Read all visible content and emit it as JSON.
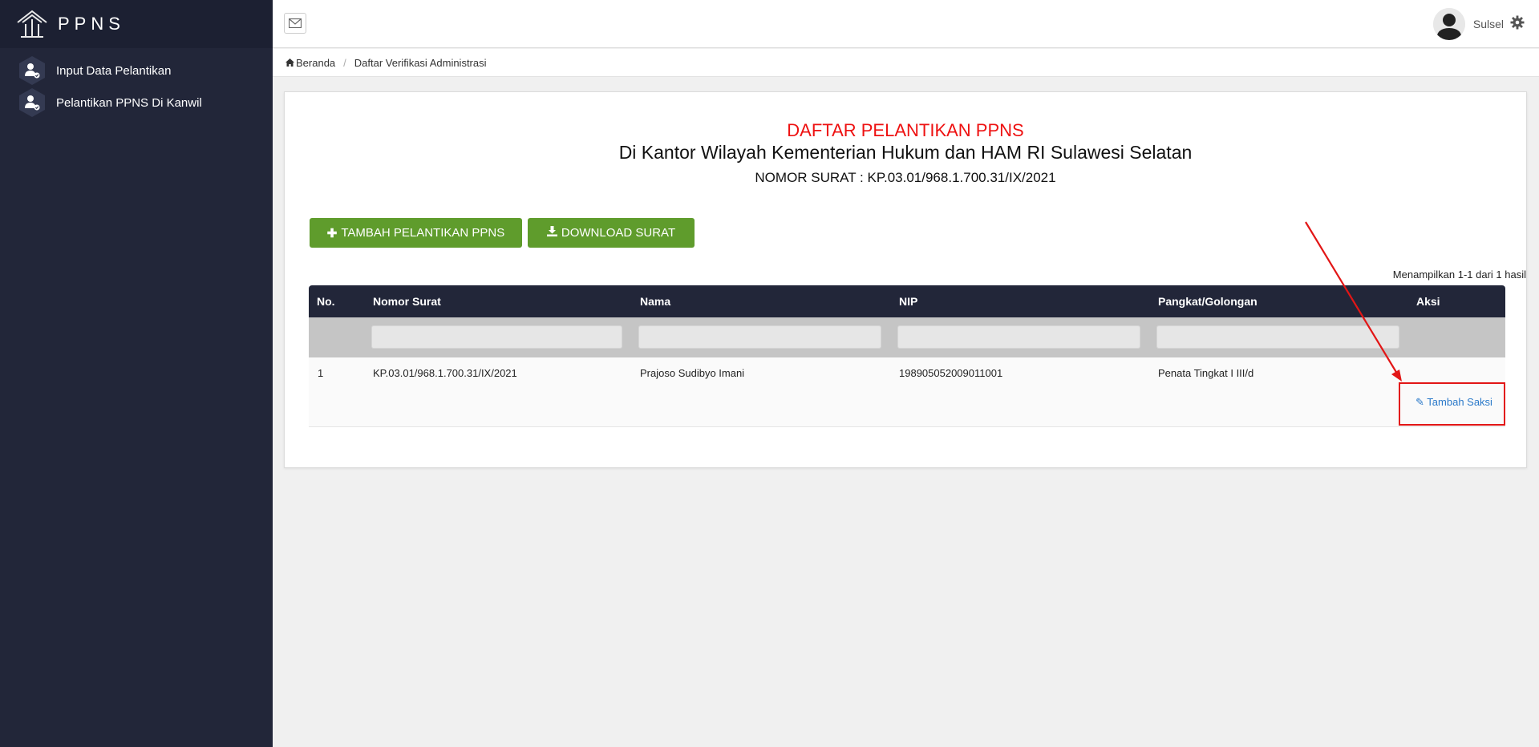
{
  "brand": {
    "name": "PPNS"
  },
  "sidebar": {
    "items": [
      {
        "label": "Input Data Pelantikan",
        "icon": "user-check-icon"
      },
      {
        "label": "Pelantikan PPNS Di Kanwil",
        "icon": "user-check-icon"
      }
    ]
  },
  "topbar": {
    "username": "Sulsel",
    "mail_icon": "mail-icon",
    "settings_icon": "gear-icon"
  },
  "breadcrumb": {
    "home": "Beranda",
    "current": "Daftar Verifikasi Administrasi"
  },
  "page": {
    "title": "DAFTAR PELANTIKAN PPNS",
    "subtitle": "Di Kantor Wilayah Kementerian Hukum dan HAM RI Sulawesi Selatan",
    "nomor": "NOMOR SURAT : KP.03.01/968.1.700.31/IX/2021"
  },
  "buttons": {
    "tambah": "TAMBAH PELANTIKAN PPNS",
    "download": "DOWNLOAD SURAT"
  },
  "table": {
    "summary": "Menampilkan 1-1 dari 1 hasil",
    "headers": [
      "No.",
      "Nomor Surat",
      "Nama",
      "NIP",
      "Pangkat/Golongan",
      "Aksi"
    ],
    "rows": [
      {
        "no": "1",
        "nomor_surat": "KP.03.01/968.1.700.31/IX/2021",
        "nama": "Prajoso Sudibyo Imani",
        "nip": "198905052009011001",
        "pangkat": "Penata Tingkat I III/d",
        "aksi": "Tambah Saksi"
      }
    ]
  },
  "colors": {
    "sidebar": "#222639",
    "accent_green": "#5f9c2c",
    "title_red": "#ee1111",
    "link_blue": "#2a79c9",
    "annotation_red": "#e21616"
  }
}
